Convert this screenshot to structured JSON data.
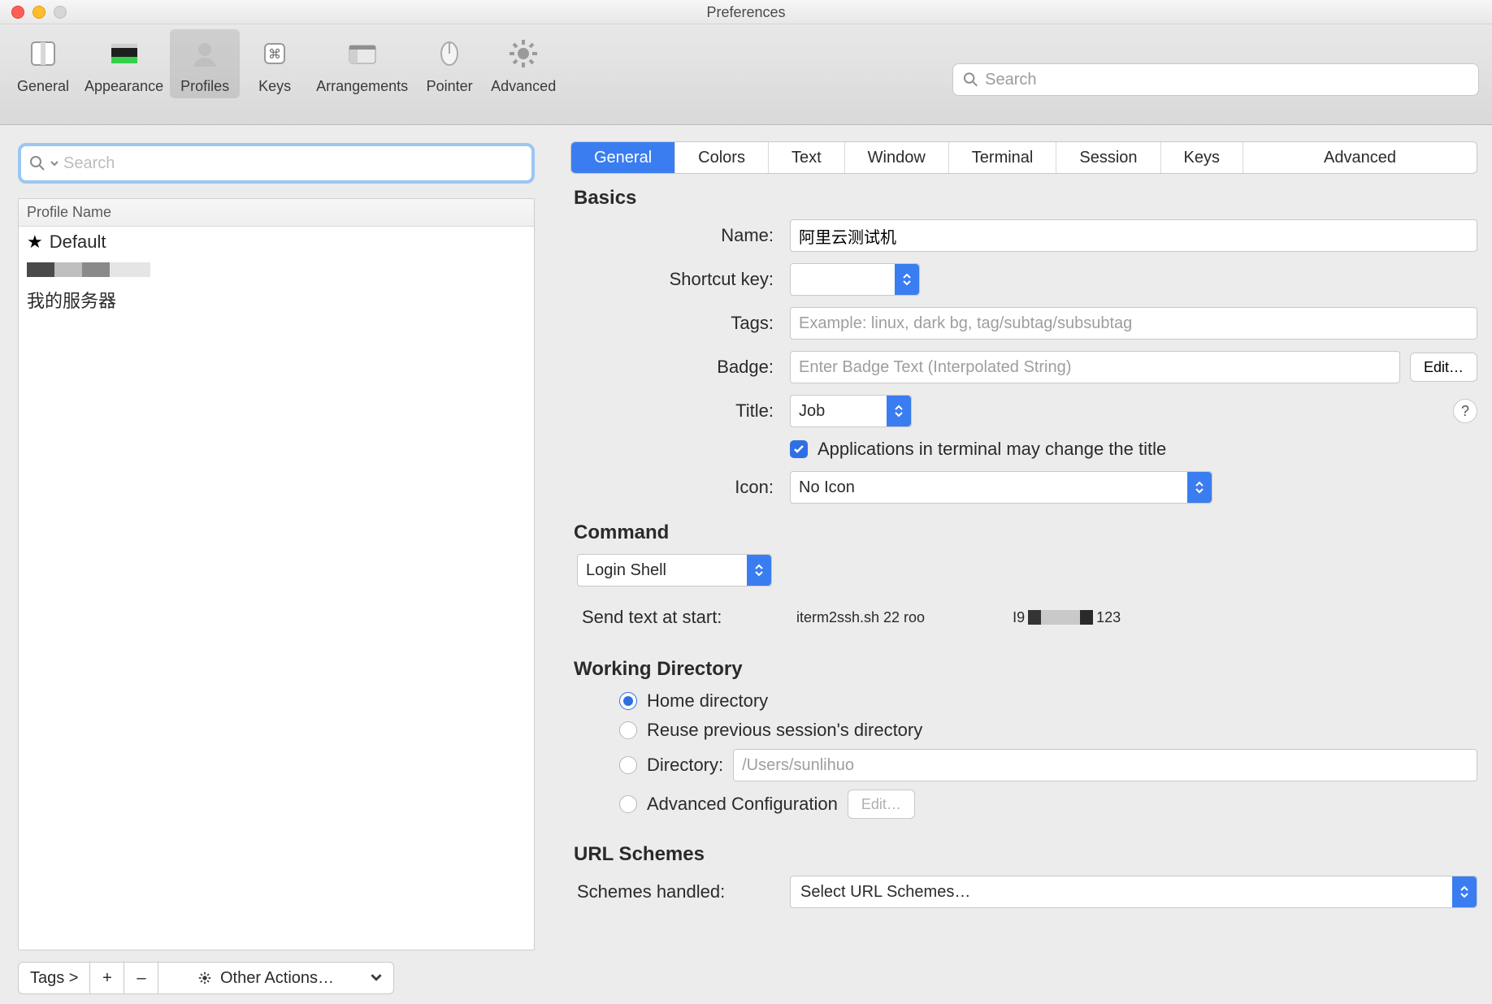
{
  "window": {
    "title": "Preferences"
  },
  "toolbar": {
    "search_placeholder": "Search",
    "items": [
      {
        "id": "general",
        "label": "General"
      },
      {
        "id": "appearance",
        "label": "Appearance"
      },
      {
        "id": "profiles",
        "label": "Profiles",
        "active": true
      },
      {
        "id": "keys",
        "label": "Keys"
      },
      {
        "id": "arrangements",
        "label": "Arrangements"
      },
      {
        "id": "pointer",
        "label": "Pointer"
      },
      {
        "id": "advanced",
        "label": "Advanced"
      }
    ]
  },
  "sidebar": {
    "search_placeholder": "Search",
    "header": "Profile Name",
    "rows": [
      {
        "label": "Default",
        "starred": true
      },
      {
        "label": "",
        "redacted": true
      },
      {
        "label": "我的服务器"
      }
    ],
    "footer": {
      "tags_label": "Tags >",
      "plus": "+",
      "minus": "–",
      "other_actions": "Other Actions…"
    }
  },
  "content": {
    "tabs": [
      "General",
      "Colors",
      "Text",
      "Window",
      "Terminal",
      "Session",
      "Keys",
      "Advanced"
    ],
    "active_tab": "General",
    "sections": {
      "basics": {
        "title": "Basics",
        "name_label": "Name:",
        "name_value": "阿里云测试机",
        "shortcut_label": "Shortcut key:",
        "shortcut_value": "",
        "tags_label": "Tags:",
        "tags_placeholder": "Example: linux, dark bg, tag/subtag/subsubtag",
        "badge_label": "Badge:",
        "badge_placeholder": "Enter Badge Text (Interpolated String)",
        "badge_edit": "Edit…",
        "title_label": "Title:",
        "title_value": "Job",
        "title_checkbox": "Applications in terminal may change the title",
        "icon_label": "Icon:",
        "icon_value": "No Icon",
        "help": "?"
      },
      "command": {
        "title": "Command",
        "shell_value": "Login Shell",
        "send_label": "Send text at start:",
        "send_value_pre": "iterm2ssh.sh 22 roo",
        "send_value_mid": "I9",
        "send_value_post": "123"
      },
      "workdir": {
        "title": "Working Directory",
        "options": [
          {
            "label": "Home directory",
            "checked": true
          },
          {
            "label": "Reuse previous session's directory"
          },
          {
            "label": "Directory:",
            "has_input": true,
            "placeholder": "/Users/sunlihuo"
          },
          {
            "label": "Advanced Configuration",
            "has_edit": true,
            "edit_label": "Edit…"
          }
        ]
      },
      "url": {
        "title": "URL Schemes",
        "handled_label": "Schemes handled:",
        "handled_value": "Select URL Schemes…"
      }
    }
  }
}
